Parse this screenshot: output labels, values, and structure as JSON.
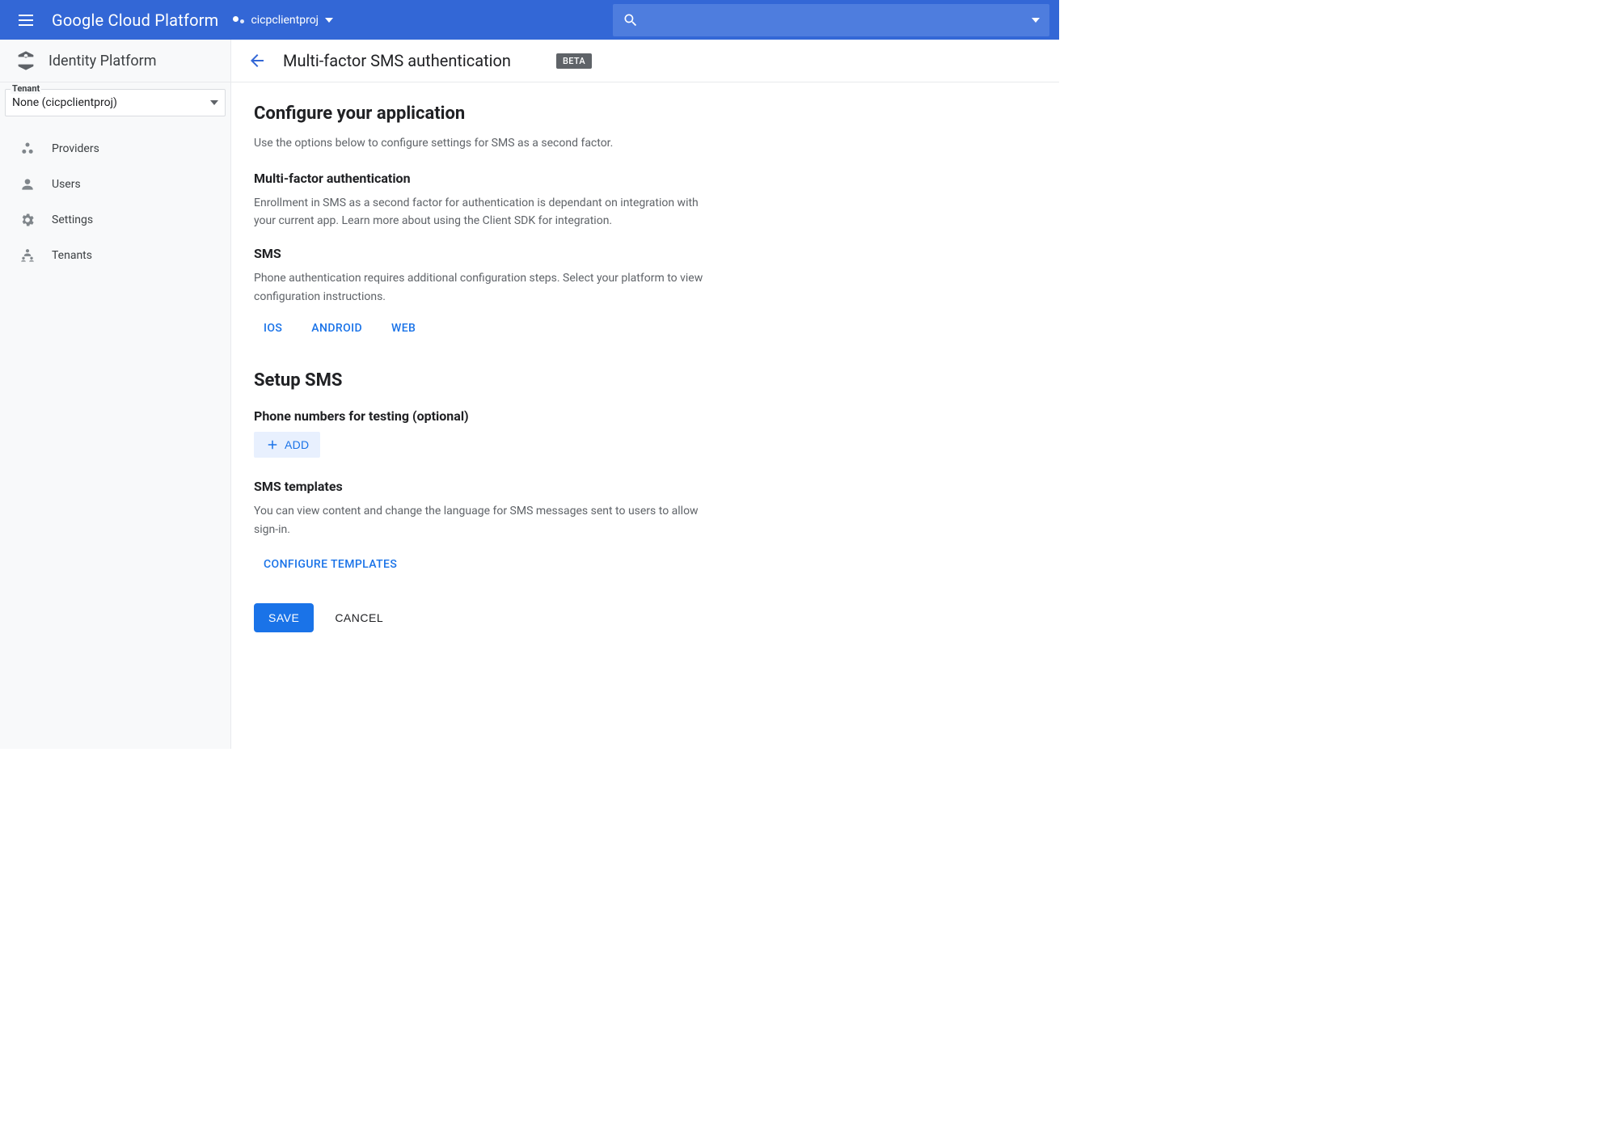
{
  "header": {
    "product_name": "Google Cloud Platform",
    "project_name": "cicpclientproj"
  },
  "sidebar": {
    "title": "Identity Platform",
    "tenant_label": "Tenant",
    "tenant_value": "None (cicpclientproj)",
    "nav": [
      {
        "label": "Providers"
      },
      {
        "label": "Users"
      },
      {
        "label": "Settings"
      },
      {
        "label": "Tenants"
      }
    ]
  },
  "page": {
    "title": "Multi-factor SMS authentication",
    "badge": "BETA",
    "section1_title": "Configure your application",
    "section1_desc": "Use the options below to configure settings for SMS as a second factor.",
    "mfa_title": "Multi-factor authentication",
    "mfa_desc": "Enrollment in SMS as a second factor for authentication is dependant on integration with your current app. Learn more about using the Client SDK for integration.",
    "sms_title": "SMS",
    "sms_desc": "Phone authentication requires additional configuration steps. Select your platform to view configuration instructions.",
    "platforms": {
      "ios": "IOS",
      "android": "ANDROID",
      "web": "WEB"
    },
    "section2_title": "Setup SMS",
    "phones_title": "Phone numbers for testing (optional)",
    "add_label": "ADD",
    "templates_title": "SMS templates",
    "templates_desc": "You can view content and change the language for SMS messages sent to users to allow sign-in.",
    "configure_templates": "CONFIGURE TEMPLATES",
    "save": "SAVE",
    "cancel": "CANCEL"
  }
}
